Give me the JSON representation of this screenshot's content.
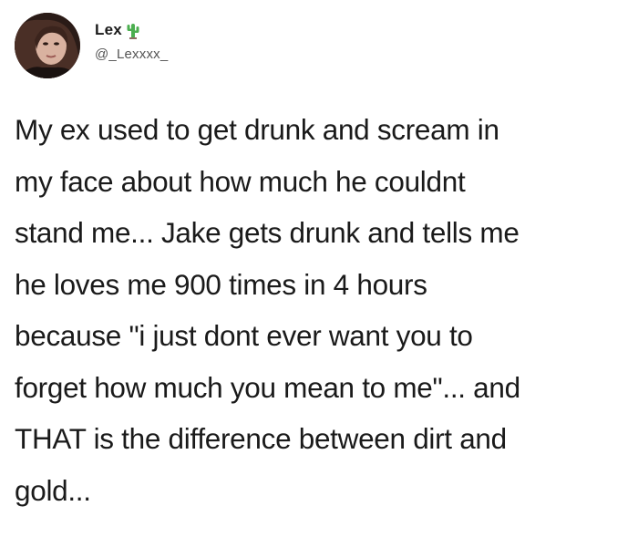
{
  "author": {
    "display_name": "Lex",
    "handle": "@_Lexxxx_",
    "badge_icon": "cactus-icon",
    "avatar_icon": "profile-photo"
  },
  "tweet": {
    "text": "My ex used to get drunk and scream in\nmy face about how much he couldnt\nstand me... Jake gets drunk and tells me\nhe loves me 900 times in 4 hours\nbecause \"i just dont ever want you to\nforget how much you mean to me\"... and\nTHAT is the difference between dirt and\ngold..."
  },
  "colors": {
    "background": "#ffffff",
    "text": "#1a1a1a",
    "handle": "#555555",
    "cactus": "#4caf50"
  }
}
